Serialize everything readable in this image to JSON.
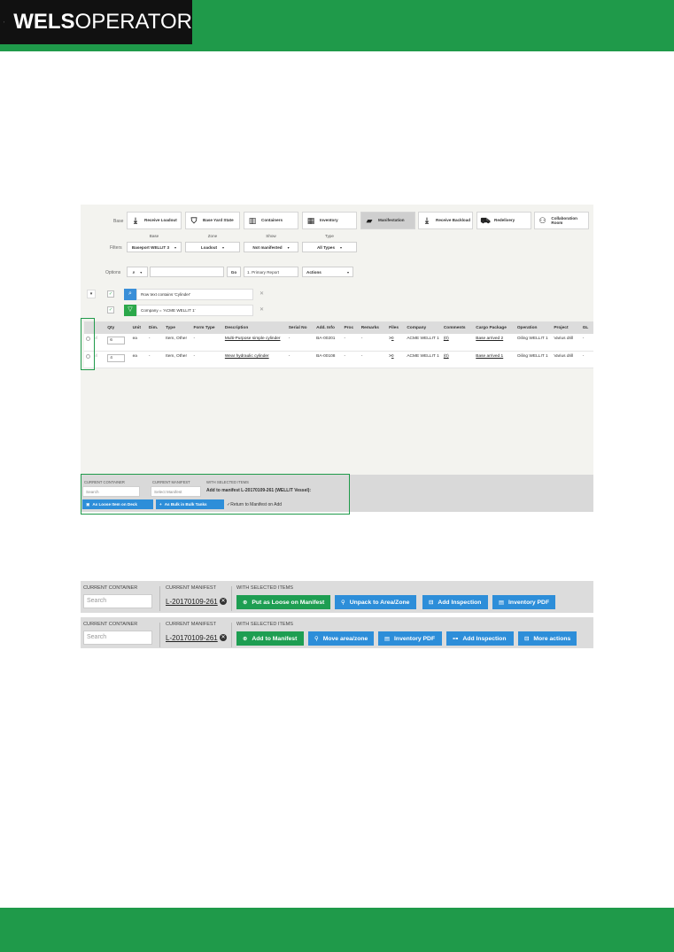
{
  "brand": {
    "bold": "WELS",
    "light": "OPERATOR"
  },
  "toolbar": {
    "base_label": "Base",
    "buttons": [
      {
        "label": "Receive Loadout",
        "icon": "tray-download-icon"
      },
      {
        "label": "Base Yard State",
        "icon": "person-group-icon"
      },
      {
        "label": "Containers",
        "icon": "crane-icon"
      },
      {
        "label": "Inventory",
        "icon": "grid-icon"
      },
      {
        "label": "Manifestation",
        "icon": "folder-icon"
      },
      {
        "label": "Receive Backload",
        "icon": "tray-download-icon"
      },
      {
        "label": "Redelivery",
        "icon": "truck-icon"
      },
      {
        "label": "Collaboration Room",
        "icon": "people-icon"
      }
    ]
  },
  "filters": {
    "label": "Filters",
    "headers": {
      "base": "Base",
      "zone": "Zone",
      "show": "Show",
      "type": "Type"
    },
    "base_value": "Baseport WELLIT 3",
    "zone_value": "Loadout",
    "show_value": "Not manifested",
    "type_value": "All Types"
  },
  "options": {
    "label": "Options",
    "go": "Go",
    "report": "1. Primary Report",
    "actions": "Actions"
  },
  "active_filters": [
    {
      "text": "Row text contains 'Cylinder'",
      "color": "#3a8fd8"
    },
    {
      "text": "Company = 'ACME WELLIT 1'",
      "color": "#2ba84a"
    }
  ],
  "table": {
    "headers": [
      "Qty",
      "Unit",
      "Dim.",
      "Type",
      "Form Type",
      "Description",
      "Serial No",
      "Add. Info",
      "Proc",
      "Remarks",
      "Files",
      "Company",
      "Comments",
      "Cargo Package",
      "Operation",
      "Project",
      "GL"
    ],
    "rows": [
      {
        "qty": "6",
        "unit": "ea",
        "dim": "-",
        "type": "Item, Other",
        "form": "-",
        "desc": "Multi-Purpose simple cylinder",
        "serial": "-",
        "add": "BA-00201",
        "proc": "-",
        "remarks": "-",
        "files": "0",
        "company": "ACME WELLIT 1",
        "comments": "(0)",
        "cargo": "Base arrived 2",
        "operation": "Oiling WELLIT 1",
        "project": "Varius drill",
        "gl": "-"
      },
      {
        "qty": "4",
        "unit": "ea",
        "dim": "-",
        "type": "Item, Other",
        "form": "-",
        "desc": "Wear hydraulic cylinder",
        "serial": "-",
        "add": "BA-00108",
        "proc": "-",
        "remarks": "-",
        "files": "0",
        "company": "ACME WELLIT 1",
        "comments": "(0)",
        "cargo": "Base arrived 1",
        "operation": "Oiling WELLIT 1",
        "project": "Varius drill",
        "gl": "-"
      }
    ]
  },
  "panel_footer": {
    "current_container": "CURRENT CONTAINER",
    "current_manifest": "CURRENT MANIFEST",
    "with_selected": "WITH SELECTED ITEMS",
    "search_placeholder": "Search",
    "manifest_placeholder": "Select Manifest",
    "add_to": "Add to manifest L-20170109-261 (WELLIT Vessel):",
    "btn_loose": "As Loose Item on Deck",
    "btn_bulk": "As Bulk in Bulk Tanks",
    "return": "Return to Manifest on Add"
  },
  "strip1": {
    "current_container": "CURRENT CONTAINER",
    "current_manifest": "CURRENT MANIFEST",
    "with_selected": "WITH SELECTED ITEMS",
    "search_placeholder": "Search",
    "manifest": "L-20170109-261",
    "buttons": [
      "Put as Loose on Manifest",
      "Unpack to Area/Zone",
      "Add Inspection",
      "Inventory PDF"
    ]
  },
  "strip2": {
    "current_container": "CURRENT CONTAINER",
    "current_manifest": "CURRENT MANIFEST",
    "with_selected": "WITH SELECTED ITEMS",
    "search_placeholder": "Search",
    "manifest": "L-20170109-261",
    "buttons": [
      "Add to Manifest",
      "Move area/zone",
      "Inventory PDF",
      "Add Inspection",
      "More actions"
    ]
  },
  "colors": {
    "brand_green": "#1f9a4a",
    "button_blue": "#2d8ed9",
    "button_green": "#1e9e52"
  }
}
